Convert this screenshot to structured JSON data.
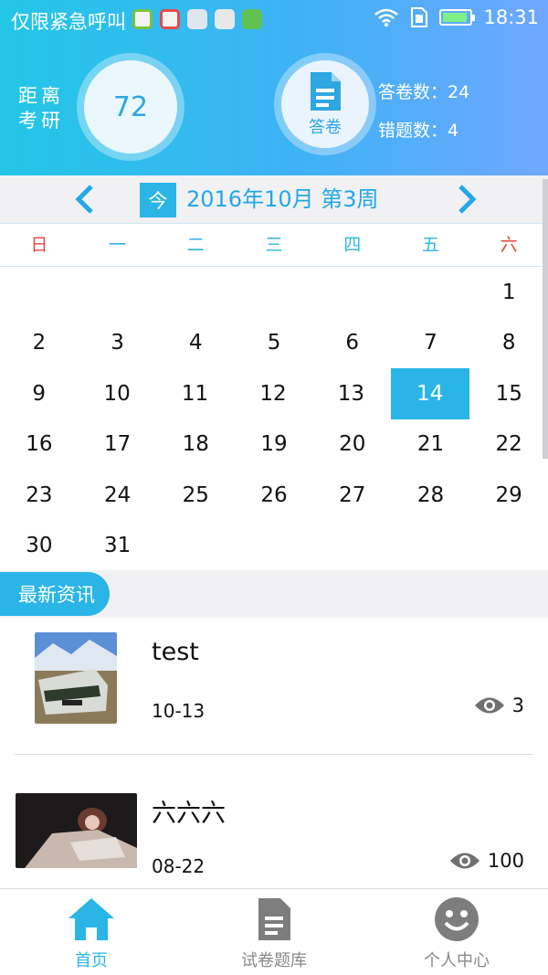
{
  "status_bar": {
    "carrier": "仅限紧急呼叫",
    "time": "18:31",
    "app_icons": [
      "app-icon",
      "app-icon",
      "app-icon",
      "app-icon",
      "message-icon"
    ]
  },
  "header": {
    "countdown_label_line1": "距离",
    "countdown_label_line2": "考研",
    "days": "72",
    "paper_label": "答卷",
    "papers_stat": "答卷数：24",
    "wrong_stat": "错题数：4"
  },
  "calendar": {
    "today_label": "今",
    "title": "2016年10月  第3周",
    "weekdays": [
      "日",
      "一",
      "二",
      "三",
      "四",
      "五",
      "六"
    ],
    "weeks": [
      [
        "",
        "",
        "",
        "",
        "",
        "",
        "1"
      ],
      [
        "2",
        "3",
        "4",
        "5",
        "6",
        "7",
        "8"
      ],
      [
        "9",
        "10",
        "11",
        "12",
        "13",
        "14",
        "15"
      ],
      [
        "16",
        "17",
        "18",
        "19",
        "20",
        "21",
        "22"
      ],
      [
        "23",
        "24",
        "25",
        "26",
        "27",
        "28",
        "29"
      ],
      [
        "30",
        "31",
        "",
        "",
        "",
        "",
        ""
      ]
    ],
    "selected": "14"
  },
  "news": {
    "section_title": "最新资讯",
    "items": [
      {
        "title": "test",
        "date": "10-13",
        "views": "3"
      },
      {
        "title": "六六六",
        "date": "08-22",
        "views": "100"
      }
    ]
  },
  "tabbar": {
    "items": [
      {
        "label": "首页",
        "icon": "home-icon"
      },
      {
        "label": "试卷题库",
        "icon": "document-icon"
      },
      {
        "label": "个人中心",
        "icon": "smiley-icon"
      }
    ]
  },
  "colors": {
    "accent": "#2ab5e6",
    "weekend": "#e2463c"
  }
}
